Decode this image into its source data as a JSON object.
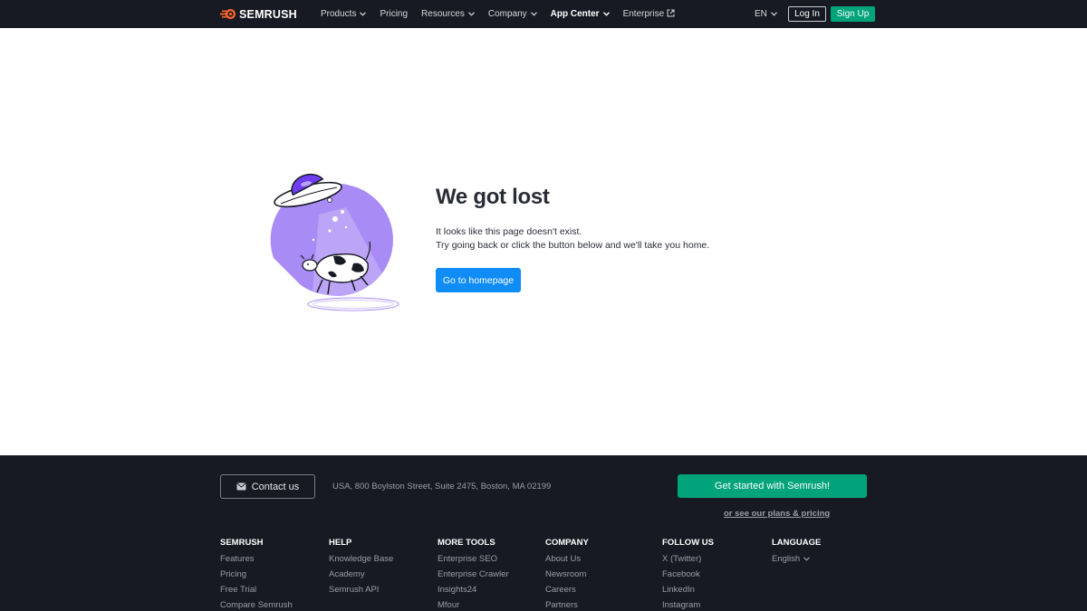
{
  "header": {
    "logo_text": "SEMRUSH",
    "nav": [
      {
        "label": "Products",
        "dropdown": true
      },
      {
        "label": "Pricing",
        "dropdown": false
      },
      {
        "label": "Resources",
        "dropdown": true
      },
      {
        "label": "Company",
        "dropdown": true
      },
      {
        "label": "App Center",
        "dropdown": true
      },
      {
        "label": "Enterprise",
        "external": true
      }
    ],
    "language": "EN",
    "login_label": "Log In",
    "signup_label": "Sign Up"
  },
  "main": {
    "title": "We got lost",
    "line1": "It looks like this page doesn't exist.",
    "line2": "Try going back or click the button below and we'll take you home.",
    "home_button": "Go to homepage"
  },
  "footer": {
    "contact_label": "Contact us",
    "address": "USA, 800 Boylston Street, Suite 2475, Boston, MA 02199",
    "cta_label": "Get started with Semrush!",
    "plans_link": "or see our plans & pricing",
    "columns": [
      {
        "title": "SEMRUSH",
        "links": [
          "Features",
          "Pricing",
          "Free Trial",
          "Compare Semrush"
        ]
      },
      {
        "title": "HELP",
        "links": [
          "Knowledge Base",
          "Academy",
          "Semrush API"
        ]
      },
      {
        "title": "MORE TOOLS",
        "links": [
          "Enterprise SEO",
          "Enterprise Crawler",
          "Insights24",
          "Mfour"
        ]
      },
      {
        "title": "COMPANY",
        "links": [
          "About Us",
          "Newsroom",
          "Careers",
          "Partners"
        ]
      },
      {
        "title": "FOLLOW US",
        "links": [
          "X (Twitter)",
          "Facebook",
          "LinkedIn",
          "Instagram"
        ]
      },
      {
        "title": "LANGUAGE",
        "links": [
          "English"
        ]
      }
    ]
  },
  "colors": {
    "brand_orange": "#ff642d",
    "accent_green": "#00a37a",
    "link_blue": "#0f8cf5",
    "illustration_purple": "#a98bf5",
    "dark_bg": "#171a22"
  },
  "icons": [
    "semrush-logo-icon",
    "chevron-down-icon",
    "external-link-icon",
    "mail-icon",
    "ufo-cow-illustration"
  ]
}
